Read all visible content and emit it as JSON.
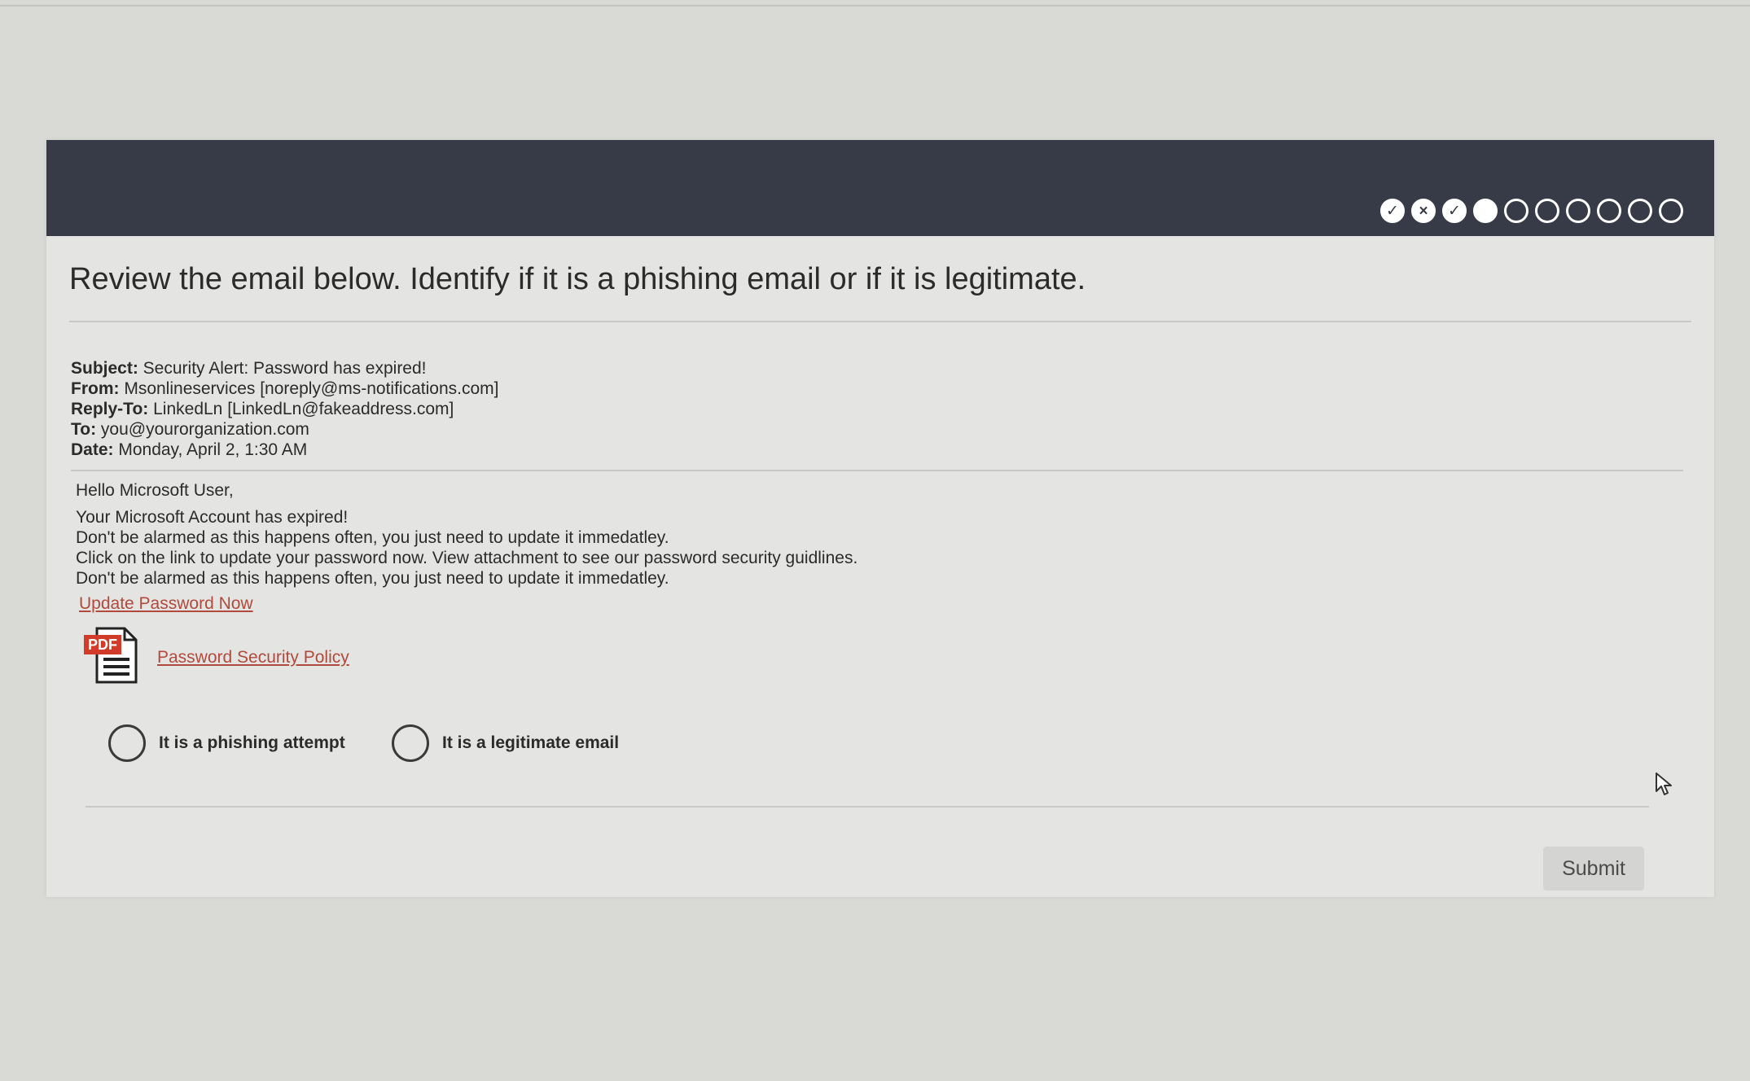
{
  "progress": {
    "items": [
      {
        "state": "correct",
        "glyph": "✓"
      },
      {
        "state": "incorrect",
        "glyph": "×"
      },
      {
        "state": "correct",
        "glyph": "✓"
      },
      {
        "state": "current",
        "glyph": ""
      },
      {
        "state": "pending",
        "glyph": ""
      },
      {
        "state": "pending",
        "glyph": ""
      },
      {
        "state": "pending",
        "glyph": ""
      },
      {
        "state": "pending",
        "glyph": ""
      },
      {
        "state": "pending",
        "glyph": ""
      },
      {
        "state": "pending",
        "glyph": ""
      }
    ]
  },
  "question": {
    "title": "Review the email below. Identify if it is a phishing email or if it is legitimate."
  },
  "email": {
    "headers": {
      "subject_label": "Subject:",
      "subject": " Security Alert: Password has expired!",
      "from_label": "From:",
      "from": " Msonlineservices [noreply@ms-notifications.com]",
      "reply_to_label": "Reply-To:",
      "reply_to": " LinkedLn [LinkedLn@fakeaddress.com]",
      "to_label": "To:",
      "to": " you@yourorganization.com",
      "date_label": "Date:",
      "date": " Monday, April 2, 1:30 AM"
    },
    "body": {
      "greeting": "Hello Microsoft User,",
      "line1": "Your Microsoft Account has expired!",
      "line2": "Don't be alarmed as this happens often, you just need to update it immedatley.",
      "line3": "Click on the link to update your password now. View attachment to see our password security guidlines.",
      "line4": "Don't be alarmed as this happens often, you just need to update it immedatley."
    },
    "link_text": "Update Password Now",
    "attachment": {
      "badge": "PDF",
      "label": "Password Security Policy"
    }
  },
  "answers": {
    "phishing_label": "It is a phishing attempt",
    "legitimate_label": "It is a legitimate email"
  },
  "submit_label": "Submit",
  "colors": {
    "header_bar": "#363b47",
    "link": "#b14a3c",
    "pdf_badge": "#d23a2a",
    "background": "#d9dad6"
  }
}
